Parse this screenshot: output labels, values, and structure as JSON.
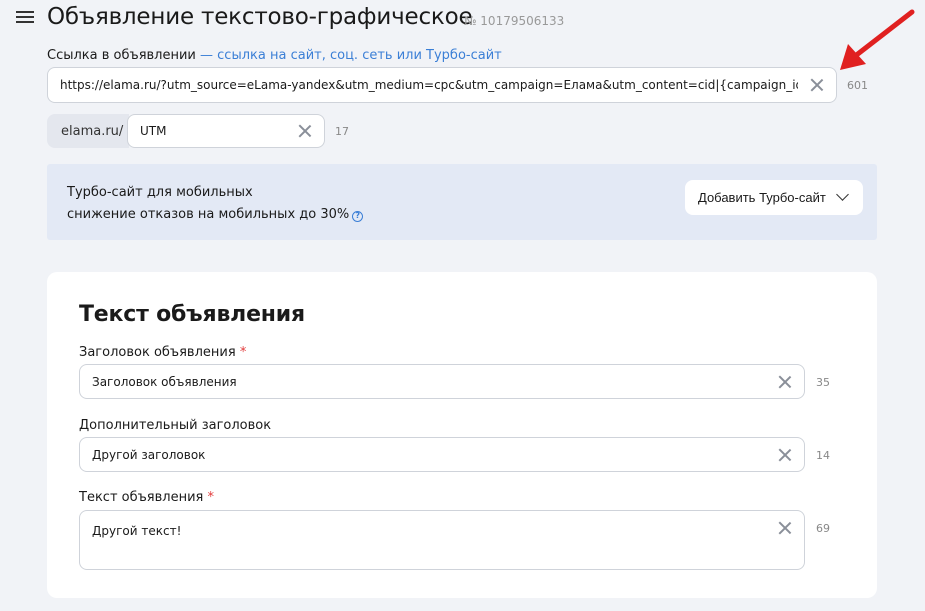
{
  "header": {
    "title": "Объявление текстово-графическое",
    "ad_number": "№ 10179506133",
    "menu_icon": "menu-icon"
  },
  "link": {
    "label": "Ссылка в объявлении",
    "hint": "— ссылка на сайт, соц. сеть или Турбо-сайт",
    "value": "https://elama.ru/?utm_source=eLama-yandex&utm_medium=cpc&utm_campaign=Елама&utm_content=cid|{campaign_id}|gid|{",
    "counter": "601"
  },
  "display_link": {
    "domain": "elama.ru/",
    "value": "UTM",
    "counter": "17"
  },
  "turbo": {
    "line1": "Турбо-сайт для мобильных",
    "line2": "снижение отказов на мобильных до 30%",
    "help_symbol": "?",
    "button_label": "Добавить Турбо-сайт"
  },
  "ad_text": {
    "section_title": "Текст объявления",
    "required_mark": "*",
    "fields": [
      {
        "label": "Заголовок объявления",
        "required": true,
        "value": "Заголовок объявления",
        "counter": "35"
      },
      {
        "label": "Дополнительный заголовок",
        "required": false,
        "value": "Другой заголовок",
        "counter": "14"
      },
      {
        "label": "Текст объявления",
        "required": true,
        "value": "Другой текст!",
        "counter": "69"
      }
    ]
  },
  "colors": {
    "accent": "#3b7fd6",
    "required": "#e23b3b",
    "arrow": "#e02020",
    "background": "#f1f3f7",
    "turbo_background": "#e3e9f5"
  }
}
